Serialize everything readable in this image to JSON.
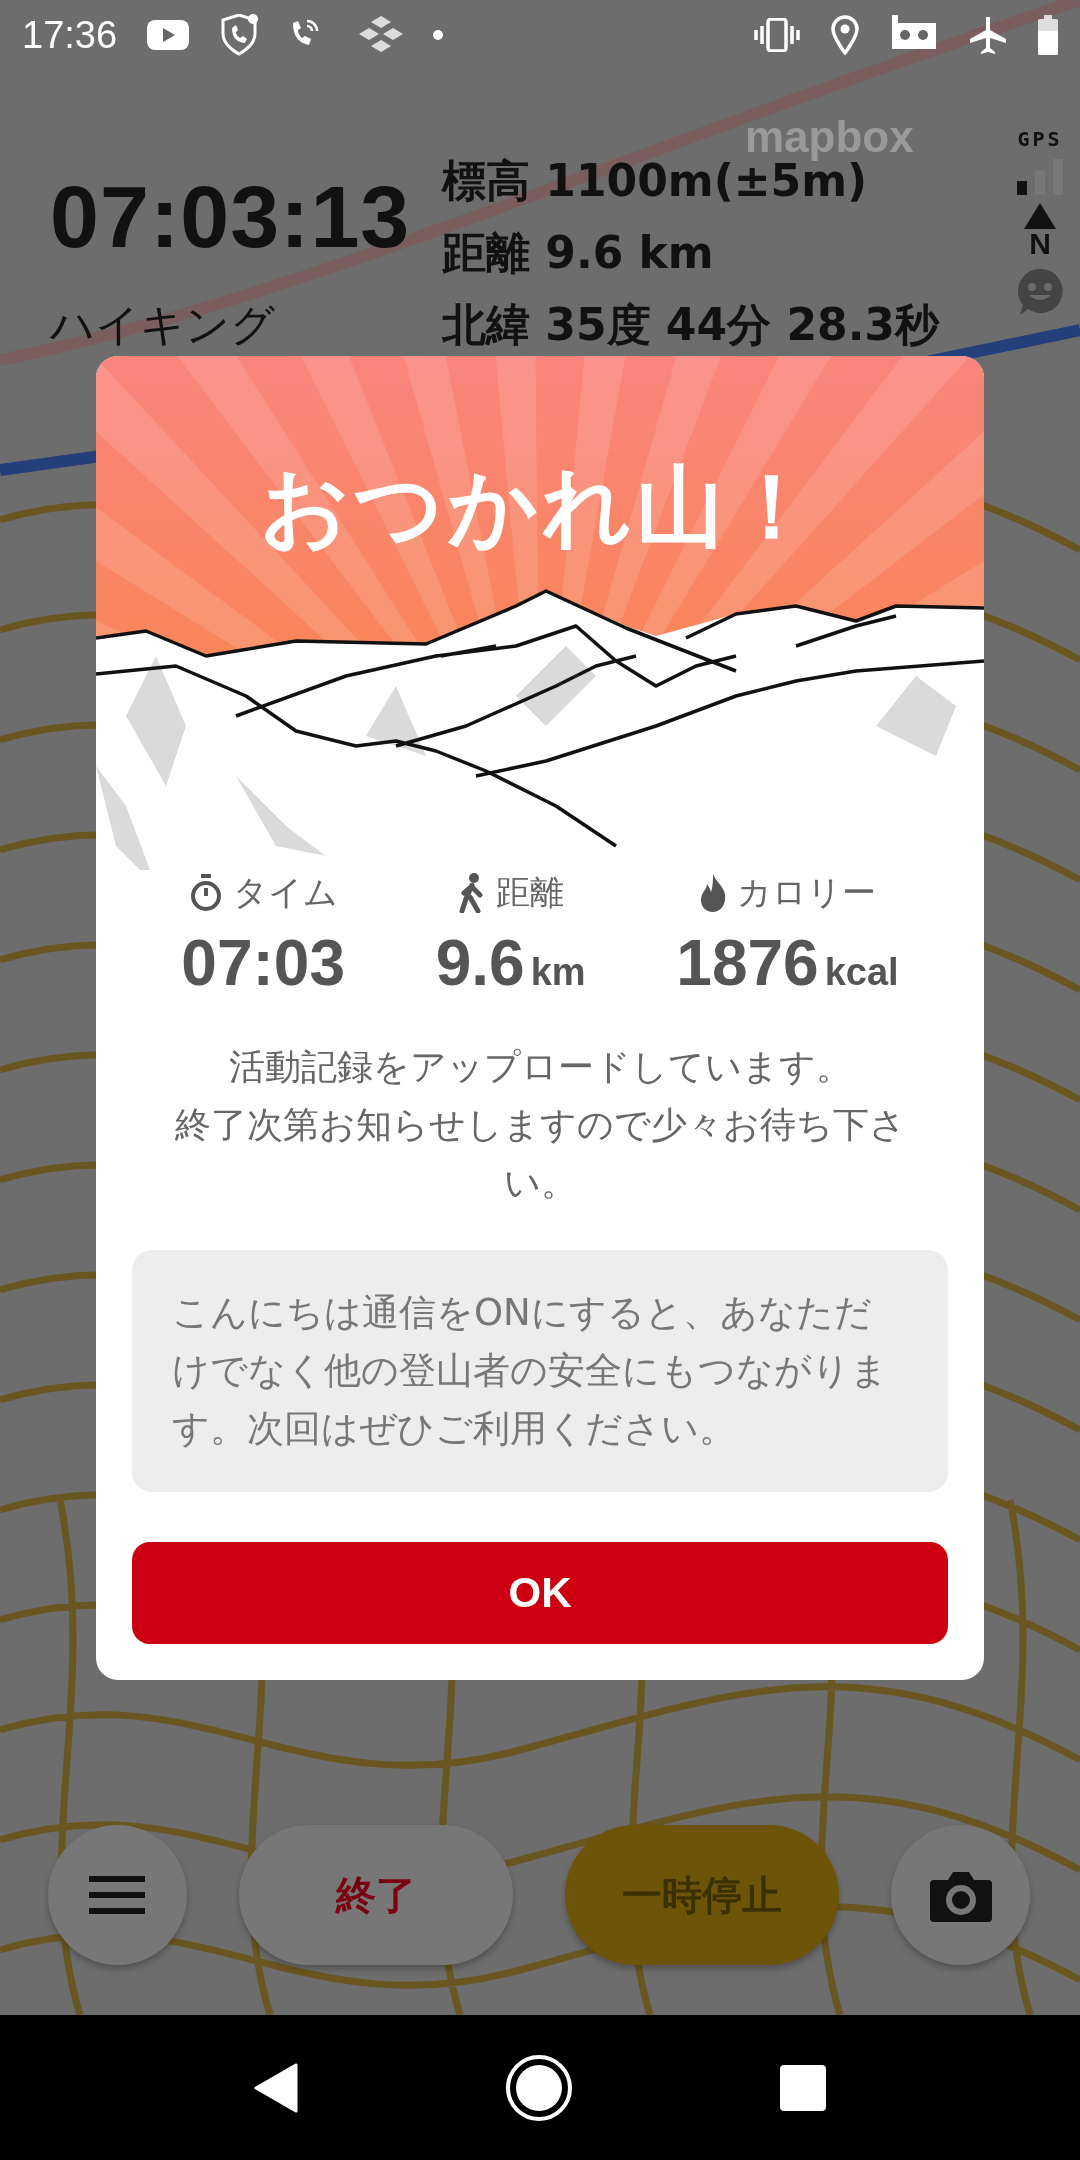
{
  "status_bar": {
    "time": "17:36"
  },
  "map": {
    "attribution": "mapbox"
  },
  "tracking_panel": {
    "elapsed": "07:03:13",
    "activity": "ハイキング",
    "readings": [
      "標高 1100m(±5m)",
      "距離 9.6 km",
      "北緯 35度 44分 28.3秒"
    ],
    "gps_label": "GPS",
    "compass_label": "N"
  },
  "dialog": {
    "title": "おつかれ山！",
    "stats": [
      {
        "kind": "time",
        "label": "タイム",
        "value": "07:03"
      },
      {
        "kind": "distance",
        "label": "距離",
        "value": "9.6",
        "unit": "km"
      },
      {
        "kind": "calories",
        "label": "カロリー",
        "value": "1876",
        "unit": "kcal"
      }
    ],
    "message": [
      "活動記録をアップロードしています。",
      "終了次第お知らせしますので少々お待ち下さい。"
    ],
    "notice": "こんにちは通信をONにすると、あなただけでなく他の登山者の安全にもつながります。次回はぜひご利用ください。",
    "button": "OK"
  },
  "controls": {
    "end": "終了",
    "pause": "一時停止"
  }
}
